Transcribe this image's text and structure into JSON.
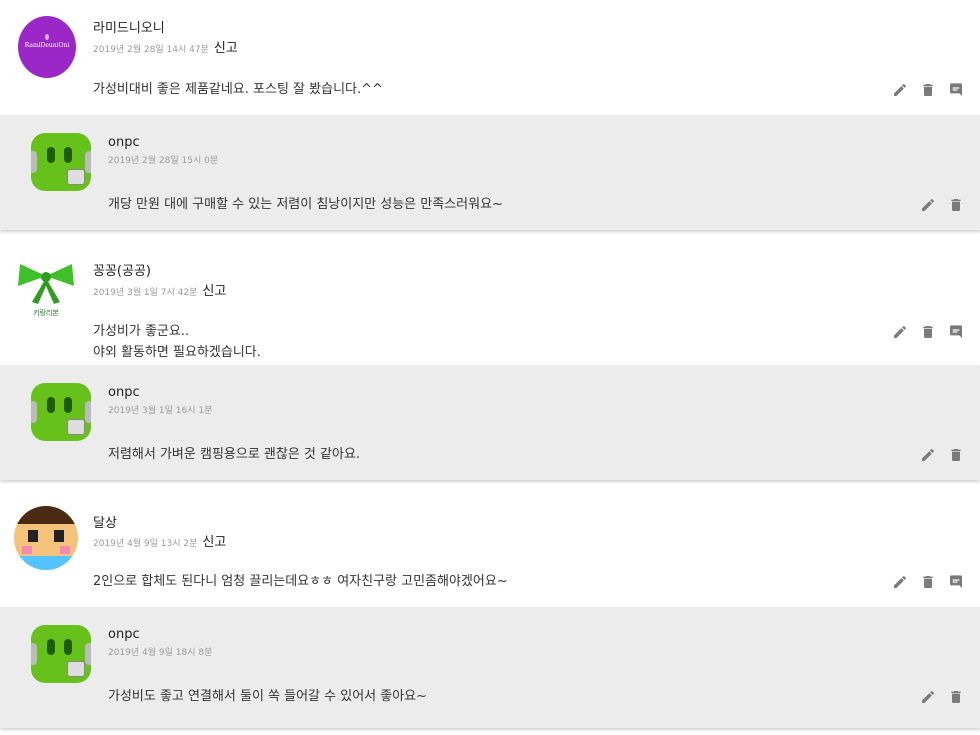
{
  "comments": [
    {
      "author": "라미드니오니",
      "date": "2019년 2월 28일 14시 47분",
      "report": "신고",
      "text": "가성비대비 좋은 제품같네요. 포스팅 잘 봤습니다.^^",
      "avatar_text": "RamiDeuniOni",
      "reply": {
        "author": "onpc",
        "date": "2019년 2월 28일 15시 0분",
        "text": "개당 만원 대에 구매할 수 있는 저렴이 침낭이지만 성능은 만족스러워요~"
      }
    },
    {
      "author": "꽁꽁(공공)",
      "date": "2019년 3월 1일 7시 42분",
      "report": "신고",
      "text": "가성비가 좋군요..\n야외 활동하면 필요하겠습니다.",
      "avatar_text": "키랑리본",
      "reply": {
        "author": "onpc",
        "date": "2019년 3월 1일 16시 1분",
        "text": "저렴해서 가벼운 캠핑용으로 괜찮은 것 같아요."
      }
    },
    {
      "author": "달상",
      "date": "2019년 4월 9일 13시 2분",
      "report": "신고",
      "text": "2인으로 합체도 된다니 엄청 끌리는데요ㅎㅎ 여자친구랑 고민좀해야겠어요~",
      "reply": {
        "author": "onpc",
        "date": "2019년 4월 9일 18시 8분",
        "text": "가성비도 좋고 연결해서 둘이 쏙 들어갈 수 있어서 좋아요~"
      }
    }
  ],
  "colors": {
    "reply_bg": "#ececec",
    "icon": "#7a7a7a",
    "purple_avatar": "#9b27c9",
    "green_robot": "#66c21a"
  },
  "icons": [
    "pencil-icon",
    "trash-icon",
    "reply-icon"
  ]
}
